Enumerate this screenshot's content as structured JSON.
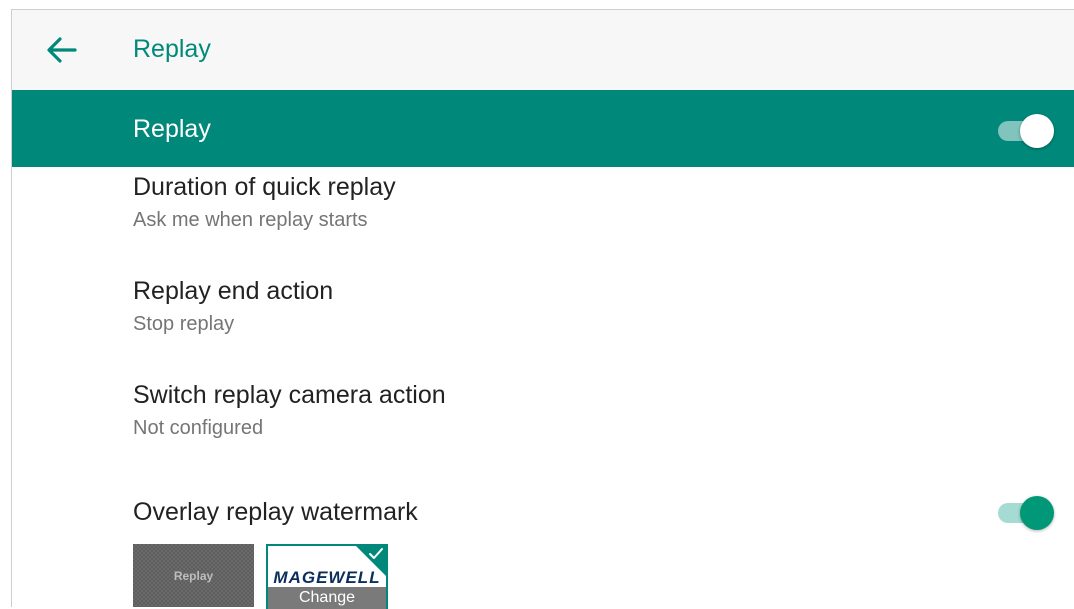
{
  "app_bar": {
    "title": "Replay"
  },
  "master": {
    "label": "Replay",
    "enabled": true
  },
  "prefs": [
    {
      "title": "Duration of quick replay",
      "summary": "Ask me when replay starts"
    },
    {
      "title": "Replay end action",
      "summary": "Stop replay"
    },
    {
      "title": "Switch replay camera action",
      "summary": "Not configured"
    }
  ],
  "overlay": {
    "title": "Overlay replay watermark",
    "enabled": true,
    "watermarks": [
      {
        "label": "Replay",
        "selected": false
      },
      {
        "logo": "MAGEWELL",
        "action": "Change",
        "selected": true
      }
    ]
  },
  "colors": {
    "accent": "#00897b",
    "switch_on": "#009877"
  },
  "icons": {
    "back": "arrow-left-icon",
    "selected": "checkmark-icon"
  }
}
